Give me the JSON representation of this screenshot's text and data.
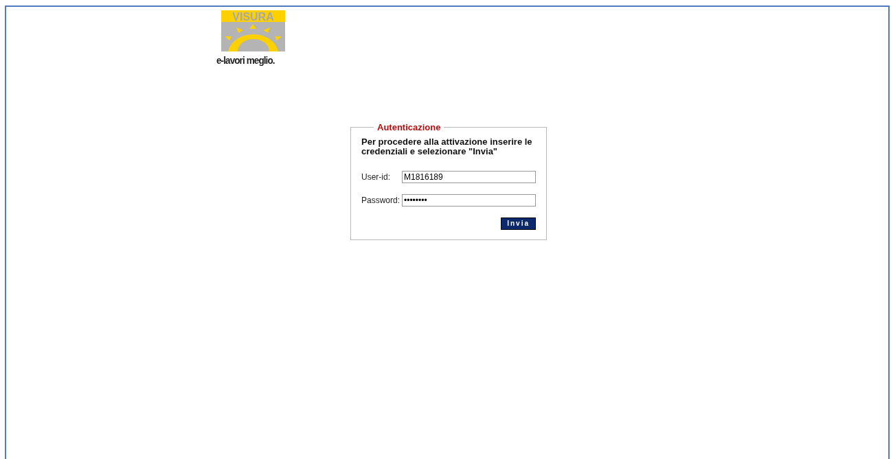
{
  "logo": {
    "brand": "VISURA",
    "tagline": "e-lavori meglio."
  },
  "login": {
    "legend": "Autenticazione",
    "instructions": "Per procedere alla attivazione inserire le credenziali e selezionare \"Invia\"",
    "fields": [
      {
        "label": "User-id:",
        "value": "M1816189"
      },
      {
        "label": "Password:",
        "value": "••••••••"
      }
    ],
    "submit": "Invia"
  }
}
